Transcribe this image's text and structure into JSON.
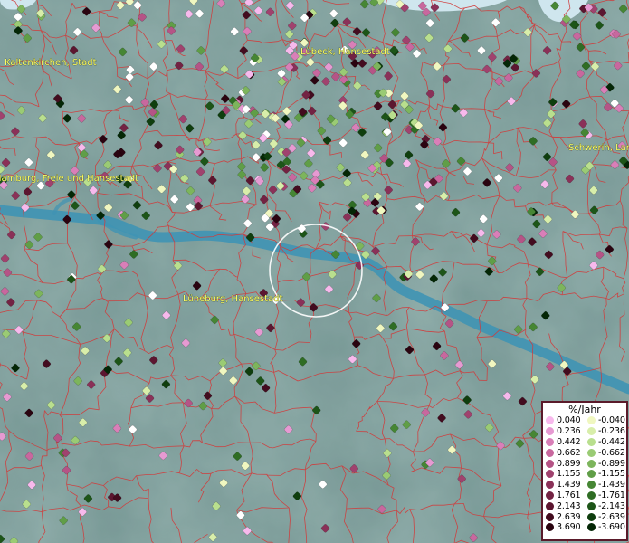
{
  "map": {
    "cities": [
      {
        "name": "Kaltenkirchen, Stadt"
      },
      {
        "name": "Lübeck, Hansestadt"
      },
      {
        "name": "Hamburg, Freie und Hansestadt"
      },
      {
        "name": "Schwerin, Landeshauptstadt"
      },
      {
        "name": "Lüneburg, Hansestadt"
      }
    ],
    "colors": {
      "land": "#7a9a98",
      "water": "#3f93b4",
      "borders": "#d23a3a",
      "focus_ring": "#ffffff"
    }
  },
  "legend": {
    "title": "%/Jahr",
    "positive": [
      {
        "label": "0.040",
        "color": "#f7b9ec"
      },
      {
        "label": "0.236",
        "color": "#e69ad2"
      },
      {
        "label": "0.442",
        "color": "#d97fb8"
      },
      {
        "label": "0.662",
        "color": "#c8689e"
      },
      {
        "label": "0.899",
        "color": "#b55486"
      },
      {
        "label": "1.155",
        "color": "#a0426e"
      },
      {
        "label": "1.439",
        "color": "#8a3158"
      },
      {
        "label": "1.761",
        "color": "#732343"
      },
      {
        "label": "2.143",
        "color": "#5c1630"
      },
      {
        "label": "2.639",
        "color": "#430c1f"
      },
      {
        "label": "3.690",
        "color": "#2a0410"
      }
    ],
    "negative": [
      {
        "label": "-0.040",
        "color": "#f0f7c0"
      },
      {
        "label": "-0.236",
        "color": "#d8eeaa"
      },
      {
        "label": "-0.442",
        "color": "#b9df8e"
      },
      {
        "label": "-0.662",
        "color": "#9acb74"
      },
      {
        "label": "-0.899",
        "color": "#7db55c"
      },
      {
        "label": "-1.155",
        "color": "#609e47"
      },
      {
        "label": "-1.439",
        "color": "#468634"
      },
      {
        "label": "-1.761",
        "color": "#2f6d24"
      },
      {
        "label": "-2.143",
        "color": "#1d5518"
      },
      {
        "label": "-2.639",
        "color": "#0f3e0e"
      },
      {
        "label": "-3.690",
        "color": "#042706"
      }
    ]
  }
}
